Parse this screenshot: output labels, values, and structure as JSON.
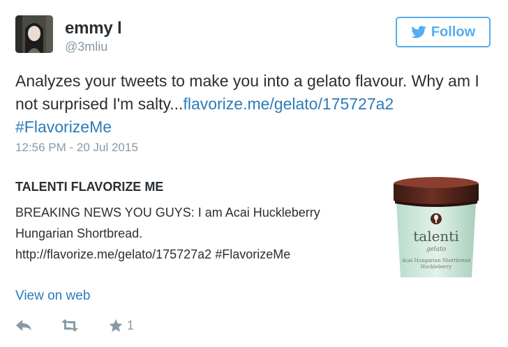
{
  "user": {
    "display_name": "emmy l",
    "handle": "@3mliu"
  },
  "follow_button": {
    "label": "Follow"
  },
  "tweet": {
    "text_before_link": "Analyzes your tweets to make you into a gelato flavour. Why am I not surprised I'm salty...",
    "link": "flavorize.me/gelato/175727a2",
    "hashtag": "#FlavorizeMe",
    "timestamp": "12:56 PM - 20 Jul 2015"
  },
  "card": {
    "title": "TALENTI FLAVORIZE ME",
    "description_line1": "BREAKING NEWS YOU GUYS: I am Acai Huckleberry",
    "description_line2": "Hungarian Shortbread.",
    "description_line3": "http://flavorize.me/gelato/175727a2 #FlavorizeMe",
    "image": {
      "brand": "talenti",
      "sub": "gelato",
      "flavor_line1": "Acai Hungarian Shortbread",
      "flavor_line2": "Huckleberry"
    }
  },
  "view_on_web": "View on web",
  "actions": {
    "favorite_count": "1",
    "icons": [
      "reply-icon",
      "retweet-icon",
      "favorite-icon"
    ]
  },
  "colors": {
    "link": "#2b7bb9",
    "twitter_blue": "#55acee",
    "muted": "#8899a6",
    "text": "#292f33"
  }
}
